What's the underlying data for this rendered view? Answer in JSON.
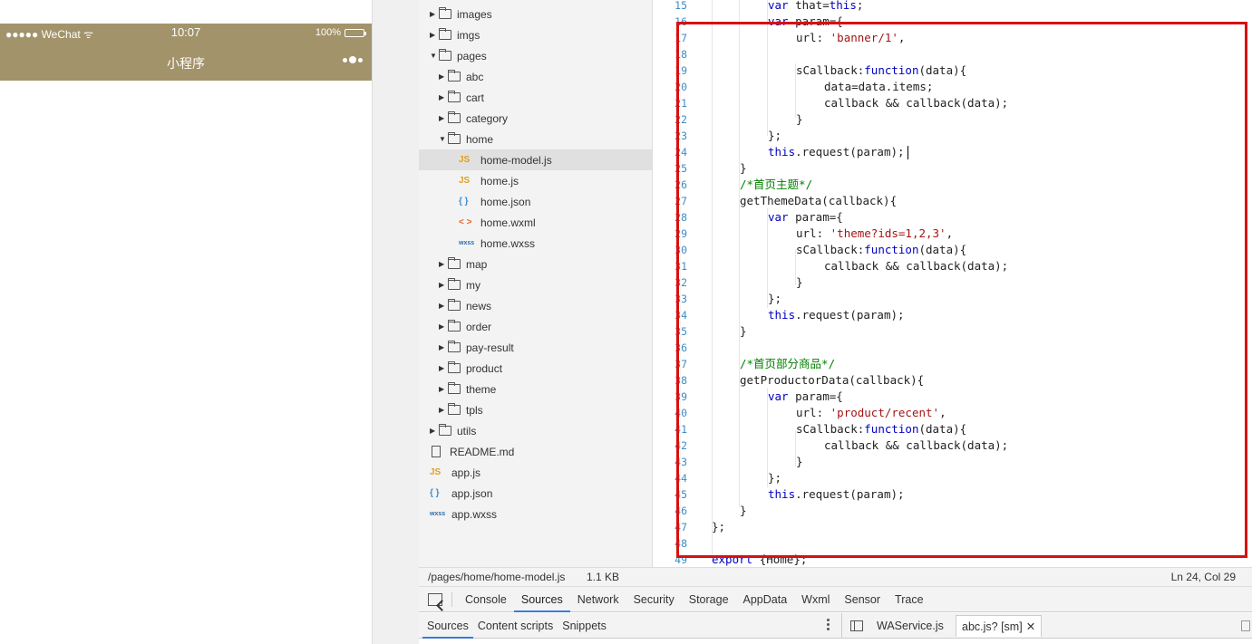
{
  "phone": {
    "status_left": "●●●●● WeChat",
    "time": "10:07",
    "battery": "100%",
    "title": "小程序"
  },
  "file_tree": [
    {
      "name": "images",
      "type": "folder",
      "depth": 1,
      "open": false
    },
    {
      "name": "imgs",
      "type": "folder",
      "depth": 1,
      "open": false
    },
    {
      "name": "pages",
      "type": "folder",
      "depth": 1,
      "open": true
    },
    {
      "name": "abc",
      "type": "folder",
      "depth": 2,
      "open": false
    },
    {
      "name": "cart",
      "type": "folder",
      "depth": 2,
      "open": false
    },
    {
      "name": "category",
      "type": "folder",
      "depth": 2,
      "open": false
    },
    {
      "name": "home",
      "type": "folder",
      "depth": 2,
      "open": true
    },
    {
      "name": "home-model.js",
      "type": "js",
      "depth": 3,
      "selected": true
    },
    {
      "name": "home.js",
      "type": "js",
      "depth": 3
    },
    {
      "name": "home.json",
      "type": "json",
      "depth": 3
    },
    {
      "name": "home.wxml",
      "type": "wxml",
      "depth": 3
    },
    {
      "name": "home.wxss",
      "type": "wxss",
      "depth": 3
    },
    {
      "name": "map",
      "type": "folder",
      "depth": 2,
      "open": false
    },
    {
      "name": "my",
      "type": "folder",
      "depth": 2,
      "open": false
    },
    {
      "name": "news",
      "type": "folder",
      "depth": 2,
      "open": false
    },
    {
      "name": "order",
      "type": "folder",
      "depth": 2,
      "open": false
    },
    {
      "name": "pay-result",
      "type": "folder",
      "depth": 2,
      "open": false
    },
    {
      "name": "product",
      "type": "folder",
      "depth": 2,
      "open": false
    },
    {
      "name": "theme",
      "type": "folder",
      "depth": 2,
      "open": false
    },
    {
      "name": "tpls",
      "type": "folder",
      "depth": 2,
      "open": false
    },
    {
      "name": "utils",
      "type": "folder",
      "depth": 1,
      "open": false
    },
    {
      "name": "README.md",
      "type": "file",
      "depth": 1
    },
    {
      "name": "app.js",
      "type": "js",
      "depth": 1
    },
    {
      "name": "app.json",
      "type": "json",
      "depth": 1
    },
    {
      "name": "app.wxss",
      "type": "wxss",
      "depth": 1
    }
  ],
  "icons": {
    "js": "JS",
    "json": "{ }",
    "wxml": "< >",
    "wxss": "wxss"
  },
  "editor": {
    "lines": [
      {
        "n": "15",
        "indent": 2,
        "tokens": [
          [
            "kw",
            "var "
          ],
          [
            "",
            "that="
          ],
          [
            "kw",
            "this"
          ],
          [
            "",
            ";"
          ]
        ]
      },
      {
        "n": "16",
        "indent": 2,
        "tokens": [
          [
            "kw",
            "var "
          ],
          [
            "",
            "param={"
          ]
        ]
      },
      {
        "n": "17",
        "indent": 3,
        "tokens": [
          [
            "",
            "url: "
          ],
          [
            "str",
            "'banner/1'"
          ],
          [
            "",
            ","
          ]
        ]
      },
      {
        "n": "18",
        "indent": 0,
        "tokens": []
      },
      {
        "n": "19",
        "indent": 3,
        "tokens": [
          [
            "",
            "sCallback:"
          ],
          [
            "kw",
            "function"
          ],
          [
            "",
            "(data){"
          ]
        ]
      },
      {
        "n": "20",
        "indent": 4,
        "tokens": [
          [
            "",
            "data=data.items;"
          ]
        ]
      },
      {
        "n": "21",
        "indent": 4,
        "tokens": [
          [
            "",
            "callback && callback(data);"
          ]
        ]
      },
      {
        "n": "22",
        "indent": 3,
        "tokens": [
          [
            "",
            "}"
          ]
        ]
      },
      {
        "n": "23",
        "indent": 2,
        "tokens": [
          [
            "",
            "};"
          ]
        ]
      },
      {
        "n": "24",
        "indent": 2,
        "tokens": [
          [
            "kw",
            "this"
          ],
          [
            "",
            ".request(param);"
          ]
        ]
      },
      {
        "n": "25",
        "indent": 1,
        "tokens": [
          [
            "",
            "}"
          ]
        ]
      },
      {
        "n": "26",
        "indent": 1,
        "tokens": [
          [
            "cmt",
            "/*首页主题*/"
          ]
        ]
      },
      {
        "n": "27",
        "indent": 1,
        "tokens": [
          [
            "",
            "getThemeData(callback){"
          ]
        ]
      },
      {
        "n": "28",
        "indent": 2,
        "tokens": [
          [
            "kw",
            "var "
          ],
          [
            "",
            "param={"
          ]
        ]
      },
      {
        "n": "29",
        "indent": 3,
        "tokens": [
          [
            "",
            "url: "
          ],
          [
            "str",
            "'theme?ids=1,2,3'"
          ],
          [
            "",
            ","
          ]
        ]
      },
      {
        "n": "30",
        "indent": 3,
        "tokens": [
          [
            "",
            "sCallback:"
          ],
          [
            "kw",
            "function"
          ],
          [
            "",
            "(data){"
          ]
        ]
      },
      {
        "n": "31",
        "indent": 4,
        "tokens": [
          [
            "",
            "callback && callback(data);"
          ]
        ]
      },
      {
        "n": "32",
        "indent": 3,
        "tokens": [
          [
            "",
            "}"
          ]
        ]
      },
      {
        "n": "33",
        "indent": 2,
        "tokens": [
          [
            "",
            "};"
          ]
        ]
      },
      {
        "n": "34",
        "indent": 2,
        "tokens": [
          [
            "kw",
            "this"
          ],
          [
            "",
            ".request(param);"
          ]
        ]
      },
      {
        "n": "35",
        "indent": 1,
        "tokens": [
          [
            "",
            "}"
          ]
        ]
      },
      {
        "n": "36",
        "indent": 0,
        "tokens": []
      },
      {
        "n": "37",
        "indent": 1,
        "tokens": [
          [
            "cmt",
            "/*首页部分商品*/"
          ]
        ]
      },
      {
        "n": "38",
        "indent": 1,
        "tokens": [
          [
            "",
            "getProductorData(callback){"
          ]
        ]
      },
      {
        "n": "39",
        "indent": 2,
        "tokens": [
          [
            "kw",
            "var "
          ],
          [
            "",
            "param={"
          ]
        ]
      },
      {
        "n": "40",
        "indent": 3,
        "tokens": [
          [
            "",
            "url: "
          ],
          [
            "str",
            "'product/recent'"
          ],
          [
            "",
            ","
          ]
        ]
      },
      {
        "n": "41",
        "indent": 3,
        "tokens": [
          [
            "",
            "sCallback:"
          ],
          [
            "kw",
            "function"
          ],
          [
            "",
            "(data){"
          ]
        ]
      },
      {
        "n": "42",
        "indent": 4,
        "tokens": [
          [
            "",
            "callback && callback(data);"
          ]
        ]
      },
      {
        "n": "43",
        "indent": 3,
        "tokens": [
          [
            "",
            "}"
          ]
        ]
      },
      {
        "n": "44",
        "indent": 2,
        "tokens": [
          [
            "",
            "};"
          ]
        ]
      },
      {
        "n": "45",
        "indent": 2,
        "tokens": [
          [
            "kw",
            "this"
          ],
          [
            "",
            ".request(param);"
          ]
        ]
      },
      {
        "n": "46",
        "indent": 1,
        "tokens": [
          [
            "",
            "}"
          ]
        ]
      },
      {
        "n": "47",
        "indent": 0,
        "tokens": [
          [
            "",
            "};"
          ]
        ]
      },
      {
        "n": "48",
        "indent": 0,
        "tokens": []
      },
      {
        "n": "49",
        "indent": 0,
        "tokens": [
          [
            "kw",
            "export "
          ],
          [
            "",
            "{Home};"
          ]
        ]
      }
    ]
  },
  "status_line": {
    "path": "/pages/home/home-model.js",
    "size": "1.1 KB",
    "position": "Ln 24, Col 29"
  },
  "devtools_tabs": [
    "Console",
    "Sources",
    "Network",
    "Security",
    "Storage",
    "AppData",
    "Wxml",
    "Sensor",
    "Trace"
  ],
  "devtools_active": "Sources",
  "sources_tabs": [
    "Sources",
    "Content scripts",
    "Snippets"
  ],
  "open_files": {
    "first": "WAService.js",
    "second": "abc.js? [sm]"
  }
}
